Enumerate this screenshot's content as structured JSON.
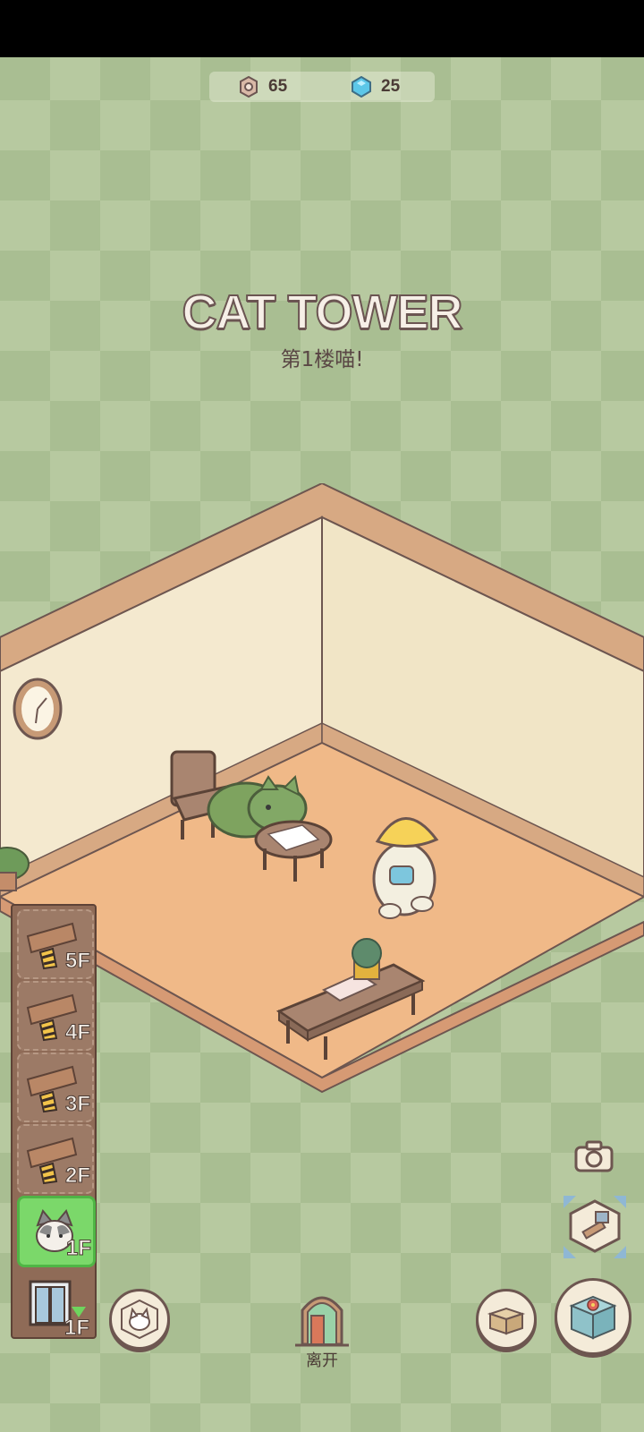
{
  "currency": {
    "coins": "65",
    "gems": "25"
  },
  "title": "CAT TOWER",
  "subtitle": "第1楼喵!",
  "floors": [
    {
      "label": "5F",
      "locked": true
    },
    {
      "label": "4F",
      "locked": true
    },
    {
      "label": "3F",
      "locked": true
    },
    {
      "label": "2F",
      "locked": true
    },
    {
      "label": "1F",
      "locked": false,
      "active": true
    }
  ],
  "elevator_floor": "1F",
  "leave_label": "离开",
  "icons": {
    "coin": "gear-coin-icon",
    "gem": "blue-gem-icon",
    "camera": "camera-icon",
    "build": "hammer-expand-icon",
    "cats": "cat-box-icon",
    "inventory": "box-icon",
    "furniture": "furniture-icon",
    "door": "door-icon",
    "elevator": "elevator-icon"
  },
  "colors": {
    "wall": "#f2e6c8",
    "floor": "#f0b988",
    "trim": "#d7a983",
    "active_floor": "#7bd86a"
  }
}
